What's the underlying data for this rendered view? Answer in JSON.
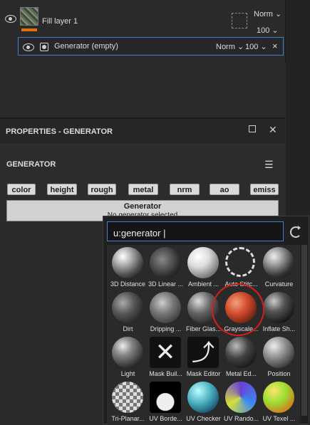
{
  "layers": {
    "fill_layer": {
      "name": "Fill layer 1",
      "blend": "Norm ⌄",
      "opacity": "100 ⌄"
    },
    "generator_row": {
      "name": "Generator (empty)",
      "blend": "Norm ⌄",
      "opacity": "100 ⌄",
      "close": "×"
    }
  },
  "properties": {
    "title": "PROPERTIES - GENERATOR",
    "section": "GENERATOR",
    "tags": [
      "color",
      "height",
      "rough",
      "metal",
      "nrm",
      "ao",
      "emiss"
    ],
    "generator_box_title": "Generator",
    "generator_box_sub": "No generator selected"
  },
  "popup": {
    "search_value": "u:generator |",
    "tiles": [
      {
        "label": "3D Distance",
        "icon": "sphere-icon"
      },
      {
        "label": "3D Linear ...",
        "icon": "sphere-icon"
      },
      {
        "label": "Ambient ...",
        "icon": "sphere-icon"
      },
      {
        "label": "Auto Stitc...",
        "icon": "dashed-circle-icon"
      },
      {
        "label": "Curvature",
        "icon": "sphere-icon"
      },
      {
        "label": "Dirt",
        "icon": "sphere-icon"
      },
      {
        "label": "Dripping ...",
        "icon": "sphere-icon"
      },
      {
        "label": "Fiber Glas...",
        "icon": "sphere-icon"
      },
      {
        "label": "Grayscale...",
        "icon": "sphere-icon"
      },
      {
        "label": "Inflate Sh...",
        "icon": "sphere-icon"
      },
      {
        "label": "Light",
        "icon": "sphere-icon"
      },
      {
        "label": "Mask Buil...",
        "icon": "tools-icon"
      },
      {
        "label": "Mask Editor",
        "icon": "wrench-icon"
      },
      {
        "label": "Metal Ed...",
        "icon": "sphere-icon"
      },
      {
        "label": "Position",
        "icon": "sphere-icon"
      },
      {
        "label": "Tri-Planar...",
        "icon": "checker-sphere-icon"
      },
      {
        "label": "UV Borde...",
        "icon": "sphere-icon"
      },
      {
        "label": "UV Checker",
        "icon": "sphere-icon"
      },
      {
        "label": "UV Rando...",
        "icon": "sphere-icon"
      },
      {
        "label": "UV Texel ...",
        "icon": "sphere-icon"
      }
    ]
  },
  "colors": {
    "accent": "#3d7fd1",
    "orange": "#e4700d",
    "highlight_ring": "#d91e18"
  }
}
